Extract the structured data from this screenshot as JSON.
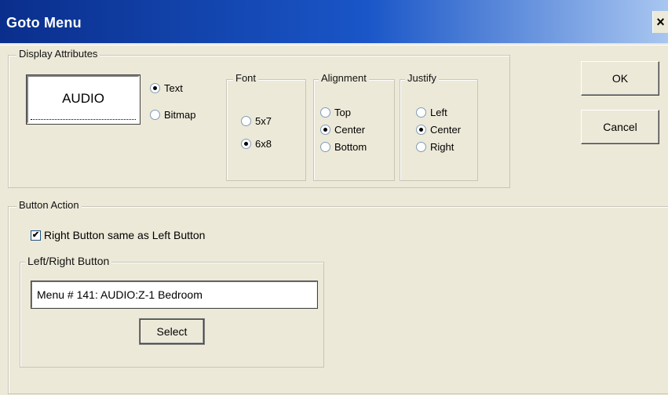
{
  "window": {
    "title": "Goto Menu",
    "close_glyph": "×"
  },
  "display_attributes": {
    "legend": "Display Attributes",
    "preview_text": "AUDIO",
    "type_options": [
      {
        "label": "Text",
        "selected": true
      },
      {
        "label": "Bitmap",
        "selected": false
      }
    ],
    "font": {
      "legend": "Font",
      "options": [
        {
          "label": "5x7",
          "selected": false
        },
        {
          "label": "6x8",
          "selected": true
        }
      ]
    },
    "alignment": {
      "legend": "Alignment",
      "options": [
        {
          "label": "Top",
          "selected": false
        },
        {
          "label": "Center",
          "selected": true
        },
        {
          "label": "Bottom",
          "selected": false
        }
      ]
    },
    "justify": {
      "legend": "Justify",
      "options": [
        {
          "label": "Left",
          "selected": false
        },
        {
          "label": "Center",
          "selected": true
        },
        {
          "label": "Right",
          "selected": false
        }
      ]
    }
  },
  "buttons": {
    "ok": "OK",
    "cancel": "Cancel"
  },
  "button_action": {
    "legend": "Button Action",
    "same_checkbox": {
      "label": "Right Button same as Left Button",
      "checked": true
    },
    "left_right": {
      "legend": "Left/Right Button",
      "value": "Menu # 141: AUDIO:Z-1 Bedroom",
      "select_label": "Select"
    }
  },
  "colors": {
    "title_start": "#0a2e8c",
    "title_end": "#a8c6f0",
    "dialog_bg": "#ece9d8"
  }
}
